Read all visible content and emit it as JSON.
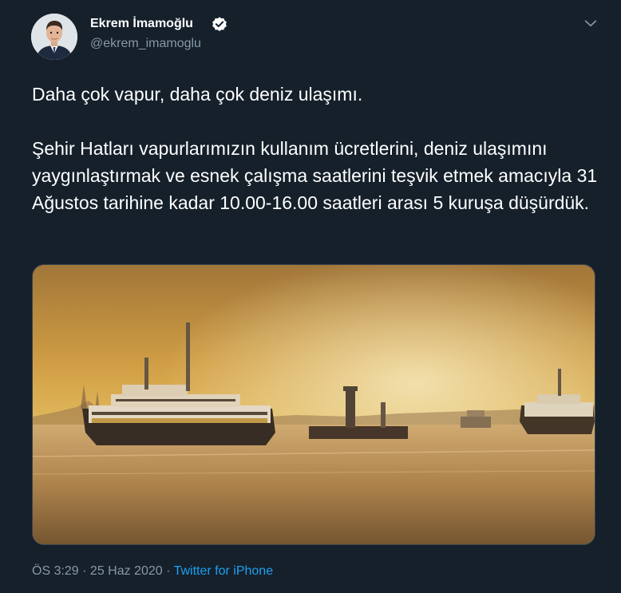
{
  "author": {
    "name": "Ekrem İmamoğlu",
    "handle": "@ekrem_imamoglu",
    "verified": true
  },
  "tweet": {
    "text_line1": "Daha çok vapur, daha çok deniz ulaşımı.",
    "text_paragraph2": "Şehir Hatları vapurlarımızın kullanım ücretlerini, deniz ulaşımını yaygınlaştırmak ve esnek çalışma saatlerini teşvik etmek amacıyla 31 Ağustos tarihine kadar 10.00-16.00 saatleri arası 5 kuruşa düşürdük."
  },
  "meta": {
    "time": "ÖS 3:29",
    "separator1": " · ",
    "date": "25 Haz 2020",
    "separator2": " · ",
    "source": "Twitter for iPhone"
  },
  "icons": {
    "verified": "verified-badge-icon",
    "menu": "chevron-down-icon"
  },
  "colors": {
    "background": "#15202b",
    "text_primary": "#ffffff",
    "text_secondary": "#8899a6",
    "link": "#1da1f2"
  }
}
